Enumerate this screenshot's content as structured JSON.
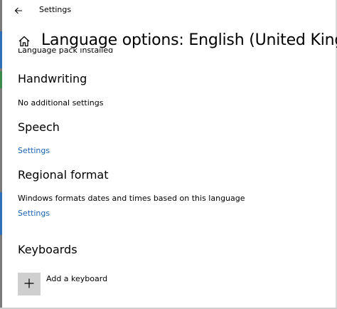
{
  "titlebar": {
    "back_icon": "back-arrow-icon",
    "title": "Settings"
  },
  "header": {
    "home_icon": "home-icon",
    "title": "Language options: English (United Kingdom)"
  },
  "language_pack_status": "Language pack installed",
  "sections": {
    "handwriting": {
      "heading": "Handwriting",
      "text": "No additional settings"
    },
    "speech": {
      "heading": "Speech",
      "link": "Settings"
    },
    "regional_format": {
      "heading": "Regional format",
      "text": "Windows formats dates and times based on this language",
      "link": "Settings"
    },
    "keyboards": {
      "heading": "Keyboards",
      "add_icon": "plus-icon",
      "add_label": "Add a keyboard"
    }
  },
  "colors": {
    "link": "#1a63b5",
    "tile": "#cfcfcf"
  }
}
